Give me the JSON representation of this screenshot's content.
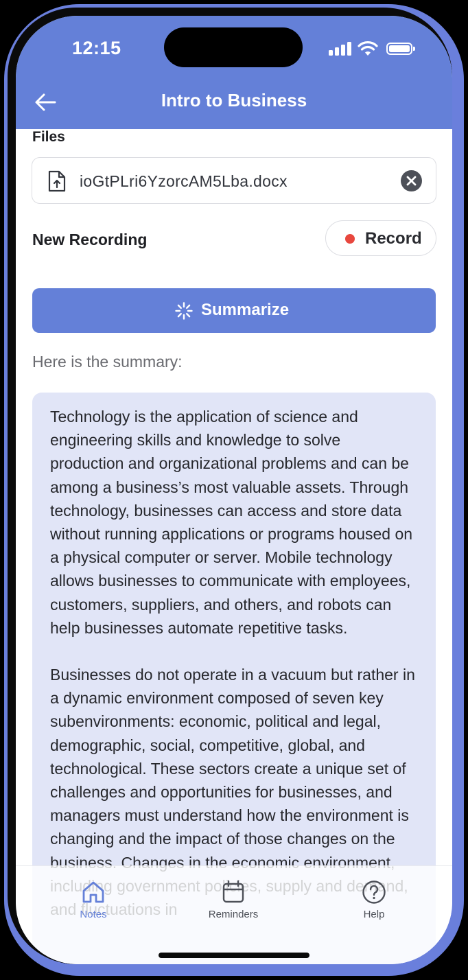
{
  "status_bar": {
    "time": "12:15"
  },
  "header": {
    "title": "Intro to Business"
  },
  "files": {
    "label": "Files",
    "file_name": "ioGtPLri6YzorcAM5Lba.docx"
  },
  "recording": {
    "label": "New Recording",
    "record_label": "Record"
  },
  "summarize": {
    "label": "Summarize"
  },
  "summary": {
    "intro": "Here is the summary:",
    "paragraphs": [
      "Technology is the application of science and engineering skills and knowledge to solve production and organizational problems and can be among a business’s most valuable assets. Through technology, businesses can access and store data without running applications or programs housed on a physical computer or server. Mobile technology allows businesses to communicate with employees, customers, suppliers, and others, and robots can help businesses automate repetitive tasks.",
      "Businesses do not operate in a vacuum but rather in a dynamic environment composed of seven key subenvironments: economic, political and legal, demographic, social, competitive, global, and technological. These sectors create a unique set of challenges and opportunities for businesses, and managers must understand how the environment is changing and the impact of those changes on the business. Changes in the economic environment, including government policies, supply and demand, and fluctuations in"
    ]
  },
  "tab_bar": {
    "tabs": [
      {
        "label": "Notes",
        "icon": "home-icon",
        "active": true
      },
      {
        "label": "Reminders",
        "icon": "calendar-icon",
        "active": false
      },
      {
        "label": "Help",
        "icon": "help-circle-icon",
        "active": false
      }
    ]
  },
  "colors": {
    "accent": "#6480d8",
    "summary_background": "#e1e5f7",
    "record_dot": "#e8473e",
    "frame": "#6a7fdc"
  }
}
